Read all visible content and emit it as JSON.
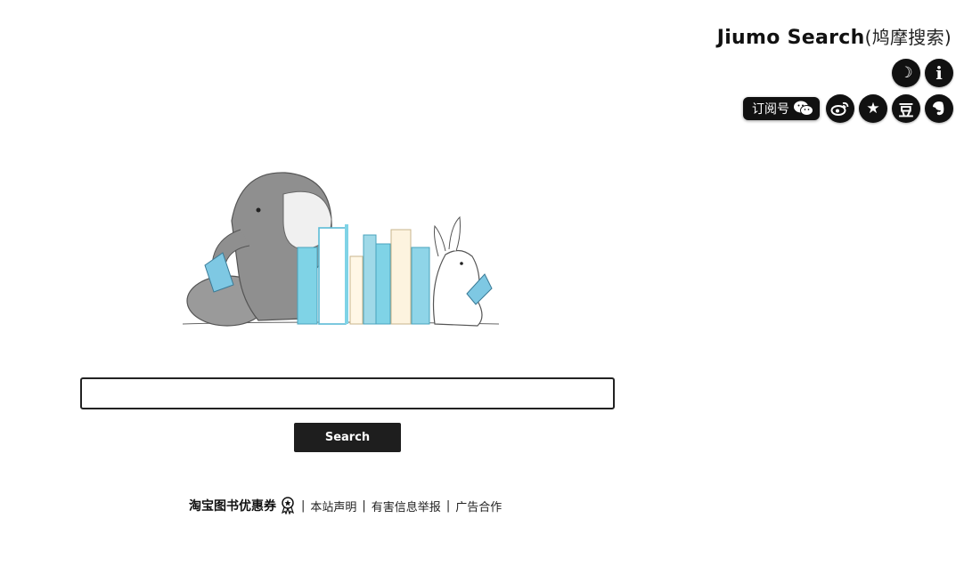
{
  "header": {
    "brand_name": "Jiumo Search",
    "brand_sub": "(鸠摩搜索)"
  },
  "top_icons": {
    "theme_icon": "☽",
    "info_icon": "i"
  },
  "social": {
    "subscribe_label": "订阅号",
    "wechat_icon": "wechat-icon",
    "weibo_icon": "weibo-icon",
    "star_glyph": "★",
    "douban_glyph": "豆",
    "evernote_icon": "evernote-icon"
  },
  "search": {
    "value": "",
    "placeholder": "",
    "button_label": "Search"
  },
  "footer": {
    "promo": "淘宝图书优惠券",
    "sep": "|",
    "links": [
      "本站声明",
      "有害信息举报",
      "广告合作"
    ]
  }
}
